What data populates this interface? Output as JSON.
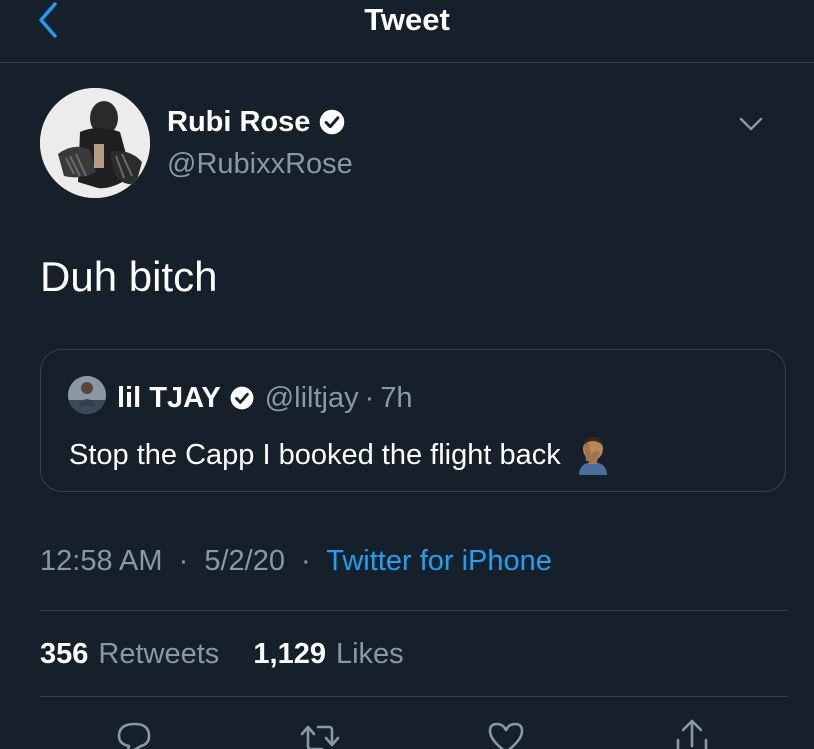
{
  "header": {
    "title": "Tweet",
    "back_icon": "chevron-left-icon"
  },
  "author": {
    "name": "Rubi Rose",
    "handle": "@RubixxRose",
    "verified": true
  },
  "tweet": {
    "text": "Duh bitch"
  },
  "quoted_tweet": {
    "name": "lil TJAY",
    "handle": "@liltjay",
    "separator": "·",
    "time_ago": "7h",
    "text": "Stop the Capp I booked the flight back",
    "emoji": "facepalm-icon"
  },
  "meta": {
    "time": "12:58 AM",
    "dot": "·",
    "date": "5/2/20",
    "dot2": "·",
    "source": "Twitter for iPhone"
  },
  "stats": {
    "retweets_count": "356",
    "retweets_label": "Retweets",
    "likes_count": "1,129",
    "likes_label": "Likes"
  },
  "actions": [
    "reply-icon",
    "retweet-icon",
    "like-icon",
    "share-icon"
  ],
  "colors": {
    "background": "#15202b",
    "border": "#38444d",
    "secondary_text": "#8899a6",
    "accent": "#1da1f2"
  }
}
